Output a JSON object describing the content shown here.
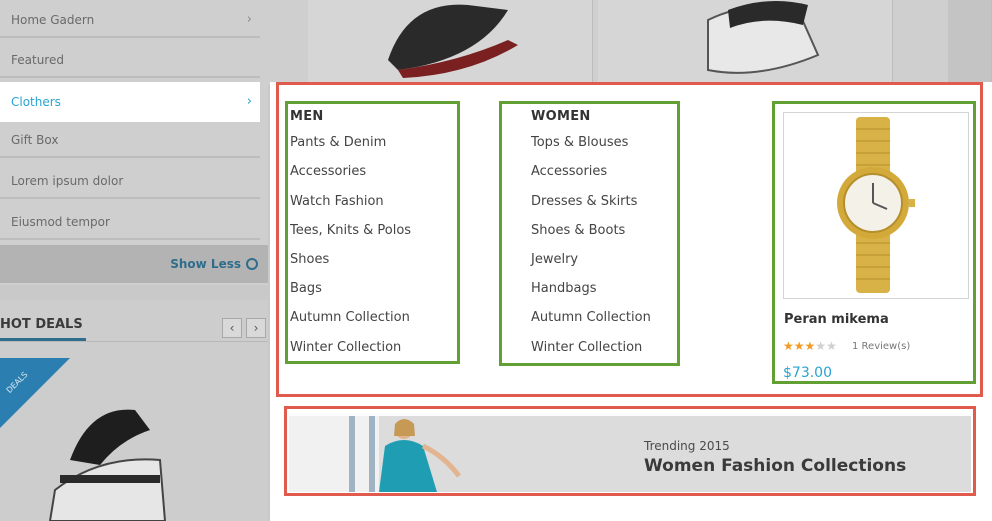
{
  "sidebar": {
    "items": [
      {
        "label": "Home Gadern",
        "has_chevron": true
      },
      {
        "label": "Featured",
        "has_chevron": false
      },
      {
        "label": "Clothers",
        "has_chevron": true
      },
      {
        "label": "Gift Box",
        "has_chevron": false
      },
      {
        "label": "Lorem ipsum dolor",
        "has_chevron": false
      },
      {
        "label": "Eiusmod tempor",
        "has_chevron": false
      }
    ],
    "active_item": "Clothers",
    "chevron_glyph": "›",
    "show_less_label": "Show Less"
  },
  "hot_deals": {
    "title": "HOT DEALS",
    "prev_glyph": "‹",
    "next_glyph": "›",
    "ribbon_text": "DEALS"
  },
  "mega_menu": {
    "men": {
      "title": "MEN",
      "links": [
        "Pants & Denim",
        "Accessories",
        "Watch Fashion",
        "Tees, Knits & Polos",
        "Shoes",
        "Bags",
        "Autumn Collection",
        "Winter Collection"
      ]
    },
    "women": {
      "title": "WOMEN",
      "links": [
        "Tops & Blouses",
        "Accessories",
        "Dresses & Skirts",
        "Shoes & Boots",
        "Jewelry",
        "Handbags",
        "Autumn Collection",
        "Winter Collection"
      ]
    },
    "product": {
      "name": "Peran mikema",
      "rating": 3,
      "rating_max": 5,
      "reviews": "1 Review(s)",
      "price": "$73.00",
      "image_icon": "wristwatch-icon"
    },
    "banner": {
      "subtitle": "Trending 2015",
      "title": "Women Fashion Collections"
    }
  },
  "colors": {
    "accent": "#29a3d1",
    "highlight_red": "#e05a4e",
    "highlight_green": "#62a033",
    "star_on": "#f39a24"
  }
}
